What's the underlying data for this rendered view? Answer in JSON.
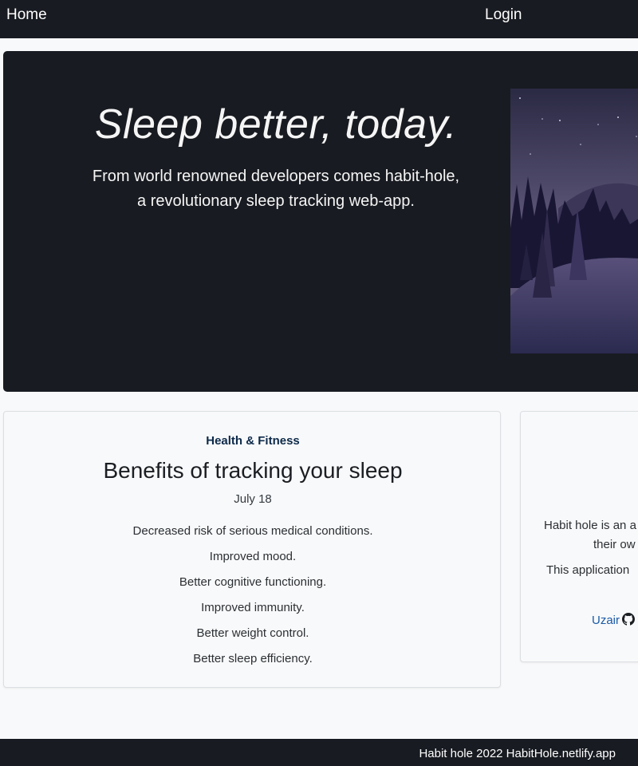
{
  "nav": {
    "home_label": "Home",
    "login_label": "Login"
  },
  "hero": {
    "title": "Sleep better, today.",
    "subtitle_line1": "From world renowned developers comes habit-hole,",
    "subtitle_line2": "a revolutionary sleep tracking web-app."
  },
  "article": {
    "category": "Health & Fitness",
    "title": "Benefits of tracking your sleep",
    "date": "July 18",
    "benefits": [
      "Decreased risk of serious medical conditions.",
      "Improved mood.",
      "Better cognitive functioning.",
      "Improved immunity.",
      "Better weight control.",
      "Better sleep efficiency."
    ]
  },
  "about": {
    "line1": "Habit hole is an a",
    "line2": "their ow",
    "line3": "This application",
    "author": "Uzair"
  },
  "footer": {
    "text": "Habit hole 2022 HabitHole.netlify.app"
  },
  "colors": {
    "dark": "#181b21",
    "background": "#f8f9fa",
    "link": "#1a5aa8",
    "category": "#0d2a4a"
  }
}
